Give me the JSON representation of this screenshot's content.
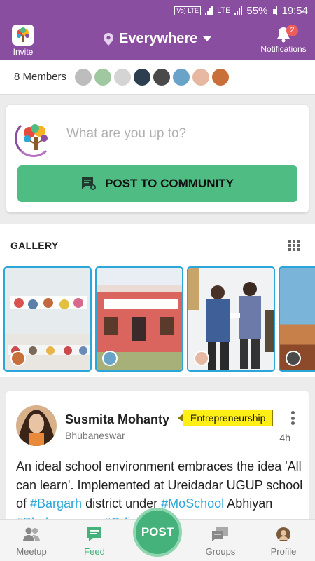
{
  "status": {
    "time": "19:54",
    "battery": "55%",
    "volte": "Vo) LTE",
    "lte": "LTE"
  },
  "topbar": {
    "invite_label": "Invite",
    "location": "Everywhere",
    "notifications_label": "Notifications",
    "notifications_count": "2"
  },
  "members": {
    "count_label": "8 Members",
    "avatars": [
      "#bdbdbd",
      "#a0c8a0",
      "#d4d4d4",
      "#2c3e50",
      "#4a4a4a",
      "#6aa3c8",
      "#e6b8a2",
      "#c96f3a"
    ]
  },
  "composer": {
    "placeholder": "What are you up to?",
    "button_label": "POST TO COMMUNITY"
  },
  "gallery": {
    "title": "GALLERY"
  },
  "post": {
    "author": "Susmita Mohanty",
    "location": "Bhubaneswar",
    "tag": "Entrepreneurship",
    "time": "4h",
    "text_1": "An ideal school environment embraces the idea 'All can learn'. Implemented at Ureidadar UGUP school of ",
    "hashtag_1": "#Bargarh",
    "text_2": " district under ",
    "hashtag_2": "#MoSchool",
    "text_3": " Abhiyan ",
    "hashtag_3": "#Bhubaneswar",
    "text_4": " ",
    "hashtag_4": "#Odisha"
  },
  "nav": {
    "meetup": "Meetup",
    "feed": "Feed",
    "post": "POST",
    "groups": "Groups",
    "profile": "Profile"
  },
  "colors": {
    "brand": "#8a4ea0",
    "accent": "#4fbc84",
    "link": "#2aa6d8",
    "tag": "#ffef16"
  }
}
